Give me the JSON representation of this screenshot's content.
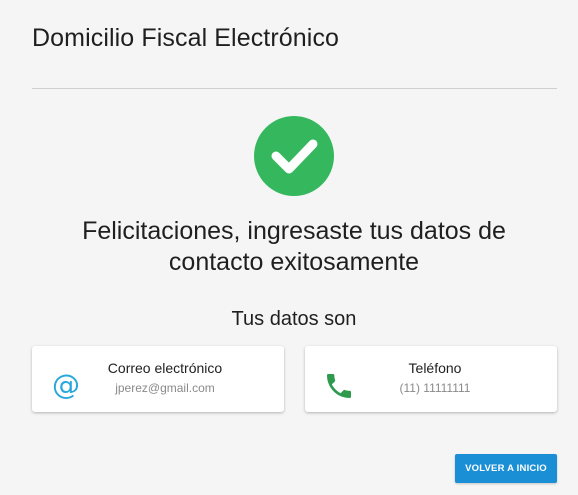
{
  "header": {
    "title": "Domicilio Fiscal Electrónico"
  },
  "success": {
    "icon": "check-circle-icon",
    "color": "#35b85d",
    "message_line1": "Felicitaciones, ingresaste tus datos de",
    "message_line2": "contacto exitosamente"
  },
  "data_section": {
    "heading": "Tus datos son",
    "cards": [
      {
        "icon": "at-sign-icon",
        "icon_color": "#29a8dc",
        "label": "Correo electrónico",
        "value": "jperez@gmail.com"
      },
      {
        "icon": "phone-icon",
        "icon_color": "#2e9a4e",
        "label": "Teléfono",
        "value": "(11) 11111111"
      }
    ]
  },
  "actions": {
    "back_button": "VOLVER A INICIO",
    "button_color": "#1a8fd6"
  }
}
